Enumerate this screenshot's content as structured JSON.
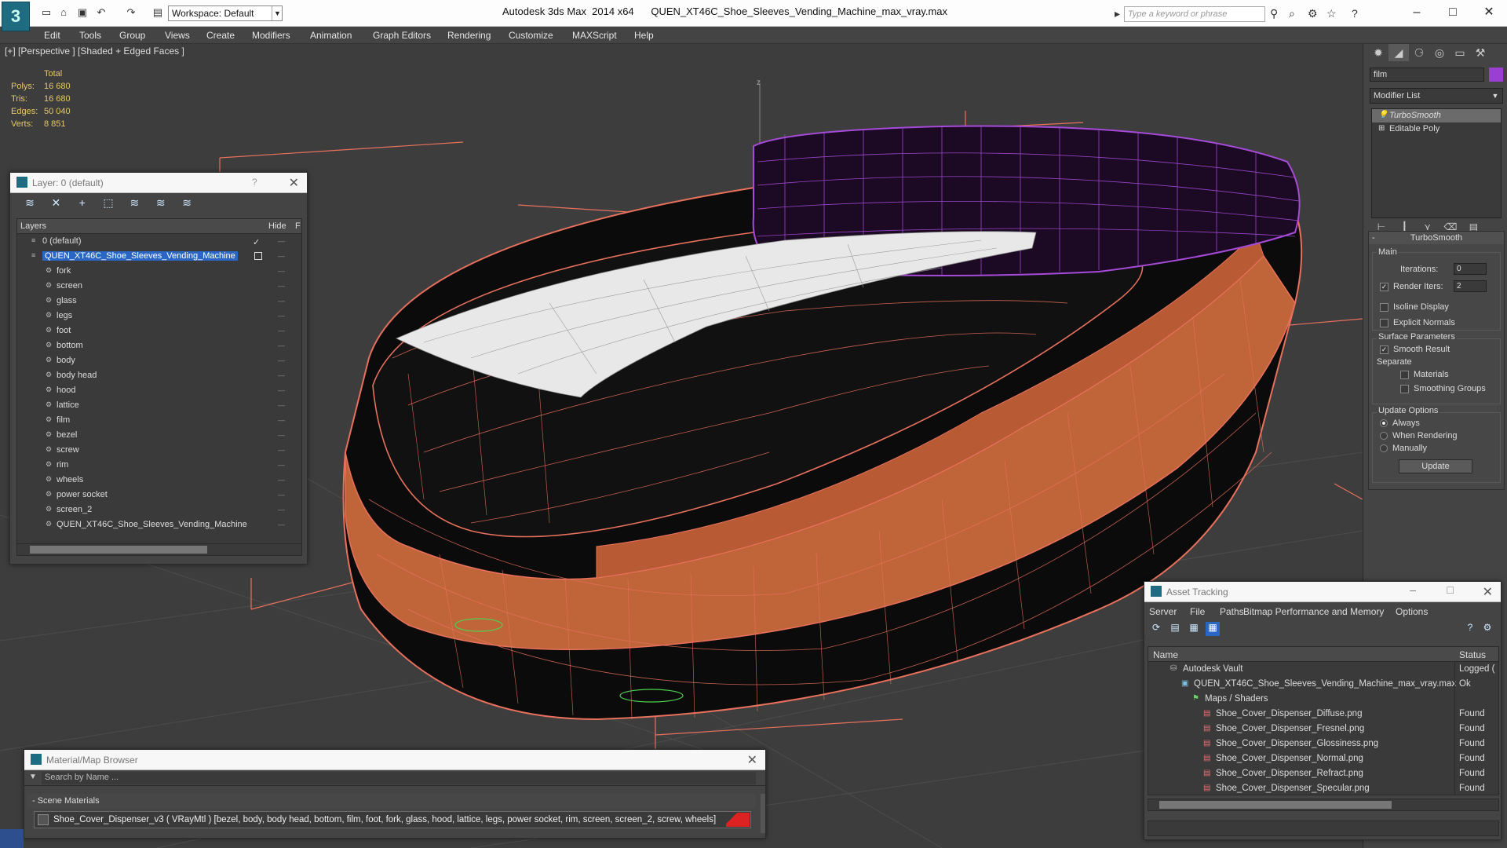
{
  "titlebar": {
    "app_title": "Autodesk 3ds Max  2014 x64      QUEN_XT46C_Shoe_Sleeves_Vending_Machine_max_vray.max",
    "workspace": "Workspace: Default",
    "search_placeholder": "Type a keyword or phrase"
  },
  "menu": [
    "Edit",
    "Tools",
    "Group",
    "Views",
    "Create",
    "Modifiers",
    "Animation",
    "Graph Editors",
    "Rendering",
    "Customize",
    "MAXScript",
    "Help"
  ],
  "viewport": {
    "label": "[+] [Perspective ] [Shaded + Edged Faces ]",
    "stats": {
      "header": "Total",
      "rows": [
        {
          "label": "Polys:",
          "value": "16 680"
        },
        {
          "label": "Tris:",
          "value": "16 680"
        },
        {
          "label": "Edges:",
          "value": "50 040"
        },
        {
          "label": "Verts:",
          "value": "8 851"
        }
      ]
    },
    "axis_label": "z"
  },
  "layer_dialog": {
    "title": "Layer: 0 (default)",
    "help": "?",
    "col_layers": "Layers",
    "col_hide": "Hide",
    "col_f": "F",
    "rows": [
      {
        "name": "0 (default)",
        "level": 0,
        "check": "✓"
      },
      {
        "name": "QUEN_XT46C_Shoe_Sleeves_Vending_Machine",
        "level": 0,
        "selected": true
      },
      {
        "name": "fork",
        "level": 1
      },
      {
        "name": "screen",
        "level": 1
      },
      {
        "name": "glass",
        "level": 1
      },
      {
        "name": "legs",
        "level": 1
      },
      {
        "name": "foot",
        "level": 1
      },
      {
        "name": "bottom",
        "level": 1
      },
      {
        "name": "body",
        "level": 1
      },
      {
        "name": "body head",
        "level": 1
      },
      {
        "name": "hood",
        "level": 1
      },
      {
        "name": "lattice",
        "level": 1
      },
      {
        "name": "film",
        "level": 1
      },
      {
        "name": "bezel",
        "level": 1
      },
      {
        "name": "screw",
        "level": 1
      },
      {
        "name": "rim",
        "level": 1
      },
      {
        "name": "wheels",
        "level": 1
      },
      {
        "name": "power socket",
        "level": 1
      },
      {
        "name": "screen_2",
        "level": 1
      },
      {
        "name": "QUEN_XT46C_Shoe_Sleeves_Vending_Machine",
        "level": 1
      }
    ]
  },
  "command_panel": {
    "object_name": "film",
    "object_color": "#9b3fd1",
    "modifier_list": "Modifier List",
    "stack": [
      {
        "name": "TurboSmooth",
        "active": true
      },
      {
        "name": "Editable Poly",
        "active": false
      }
    ],
    "turbosmooth": {
      "title": "TurboSmooth",
      "main_label": "Main",
      "iterations_label": "Iterations:",
      "iterations": "0",
      "render_iters_label": "Render Iters:",
      "render_iters": "2",
      "isoline": "Isoline Display",
      "explicit_normals": "Explicit Normals",
      "surface_params": "Surface Parameters",
      "smooth_result": "Smooth Result",
      "separate": "Separate",
      "materials": "Materials",
      "smoothing_groups": "Smoothing Groups",
      "update_options": "Update Options",
      "always": "Always",
      "when_rendering": "When Rendering",
      "manually": "Manually",
      "update_btn": "Update"
    }
  },
  "asset_tracking": {
    "title": "Asset Tracking",
    "menu": [
      "Server",
      "File",
      "Paths",
      "Bitmap Performance and Memory",
      "Options"
    ],
    "col_name": "Name",
    "col_status": "Status",
    "rows": [
      {
        "name": "Autodesk Vault",
        "status": "Logged (",
        "level": 1,
        "icon": "vault-icon"
      },
      {
        "name": "QUEN_XT46C_Shoe_Sleeves_Vending_Machine_max_vray.max",
        "status": "Ok",
        "level": 2,
        "icon": "max-file-icon"
      },
      {
        "name": "Maps / Shaders",
        "status": "",
        "level": 3,
        "icon": "maps-icon"
      },
      {
        "name": "Shoe_Cover_Dispenser_Diffuse.png",
        "status": "Found",
        "level": 4,
        "icon": "png-icon"
      },
      {
        "name": "Shoe_Cover_Dispenser_Fresnel.png",
        "status": "Found",
        "level": 4,
        "icon": "png-icon"
      },
      {
        "name": "Shoe_Cover_Dispenser_Glossiness.png",
        "status": "Found",
        "level": 4,
        "icon": "png-icon"
      },
      {
        "name": "Shoe_Cover_Dispenser_Normal.png",
        "status": "Found",
        "level": 4,
        "icon": "png-icon"
      },
      {
        "name": "Shoe_Cover_Dispenser_Refract.png",
        "status": "Found",
        "level": 4,
        "icon": "png-icon"
      },
      {
        "name": "Shoe_Cover_Dispenser_Specular.png",
        "status": "Found",
        "level": 4,
        "icon": "png-icon"
      }
    ]
  },
  "material_browser": {
    "title": "Material/Map Browser",
    "search_placeholder": "Search by Name ...",
    "group": "- Scene Materials",
    "item": "Shoe_Cover_Dispenser_v3  ( VRayMtl ) [bezel, body, body head, bottom, film, foot, fork, glass, hood, lattice, legs, power socket, rim, screen, screen_2, screw, wheels]"
  },
  "colors": {
    "accent_blue": "#2a67c4",
    "wire_orange": "#e8715d",
    "wire_purple": "#a64bd8",
    "body_orange": "#c0643a",
    "stat_yellow": "#e5c86a"
  }
}
